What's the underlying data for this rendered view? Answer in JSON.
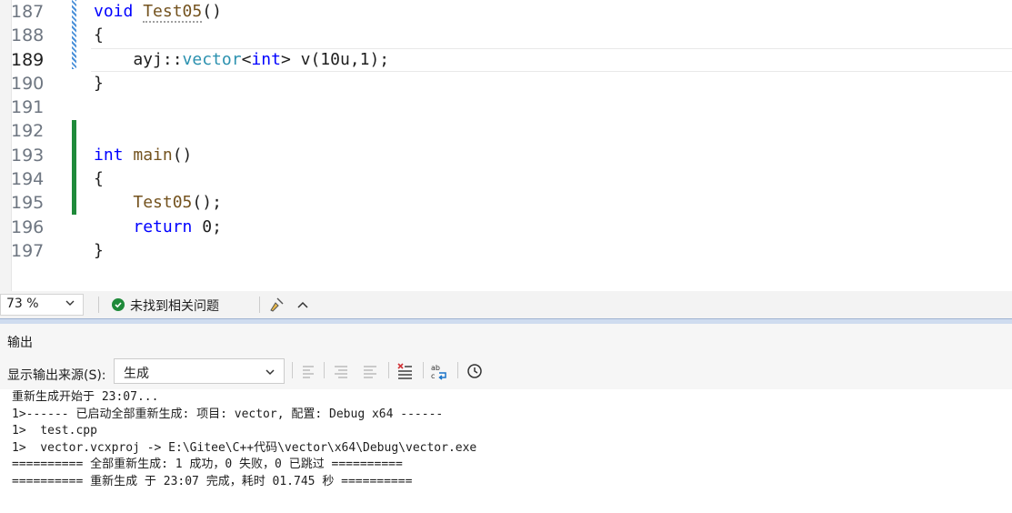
{
  "editor": {
    "lines": [
      {
        "num": "187",
        "tokens": [
          {
            "t": "void",
            "c": "kw"
          },
          {
            "t": " ",
            "c": "plain"
          },
          {
            "t": "Test05",
            "c": "fn",
            "dotted": true
          },
          {
            "t": "()",
            "c": "plain"
          }
        ]
      },
      {
        "num": "188",
        "tokens": [
          {
            "t": "{",
            "c": "plain"
          }
        ]
      },
      {
        "num": "189",
        "active": true,
        "tokens": [
          {
            "t": "    ayj::",
            "c": "plain"
          },
          {
            "t": "vector",
            "c": "type"
          },
          {
            "t": "<",
            "c": "plain"
          },
          {
            "t": "int",
            "c": "kw"
          },
          {
            "t": "> v(10u,1);",
            "c": "plain"
          }
        ]
      },
      {
        "num": "190",
        "tokens": [
          {
            "t": "}",
            "c": "plain"
          }
        ]
      },
      {
        "num": "191",
        "tokens": []
      },
      {
        "num": "192",
        "tokens": []
      },
      {
        "num": "193",
        "tokens": [
          {
            "t": "int",
            "c": "kw"
          },
          {
            "t": " ",
            "c": "plain"
          },
          {
            "t": "main",
            "c": "fn"
          },
          {
            "t": "()",
            "c": "plain"
          }
        ]
      },
      {
        "num": "194",
        "tokens": [
          {
            "t": "{",
            "c": "plain"
          }
        ]
      },
      {
        "num": "195",
        "tokens": [
          {
            "t": "    ",
            "c": "plain"
          },
          {
            "t": "Test05",
            "c": "fn"
          },
          {
            "t": "();",
            "c": "plain"
          }
        ]
      },
      {
        "num": "196",
        "tokens": [
          {
            "t": "    ",
            "c": "plain"
          },
          {
            "t": "return",
            "c": "kw"
          },
          {
            "t": " 0;",
            "c": "plain"
          }
        ]
      },
      {
        "num": "197",
        "tokens": [
          {
            "t": "}",
            "c": "plain"
          }
        ]
      }
    ]
  },
  "statusbar": {
    "zoom": "73 %",
    "issues_text": "未找到相关问题"
  },
  "output_panel": {
    "title": "输出",
    "source_label": "显示输出来源(S):",
    "source_value": "生成",
    "lines": [
      "重新生成开始于 23:07...",
      "1>------ 已启动全部重新生成: 项目: vector, 配置: Debug x64 ------",
      "1>  test.cpp",
      "1>  vector.vcxproj -> E:\\Gitee\\C++代码\\vector\\x64\\Debug\\vector.exe",
      "========== 全部重新生成: 1 成功，0 失败，0 已跳过 ==========",
      "========== 重新生成 于 23:07 完成，耗时 01.745 秒 =========="
    ]
  },
  "colors": {
    "keyword": "#0000ff",
    "function": "#74531f",
    "type": "#2b91af",
    "success": "#1f8a3a",
    "change_marker": "#1f8a3a"
  }
}
